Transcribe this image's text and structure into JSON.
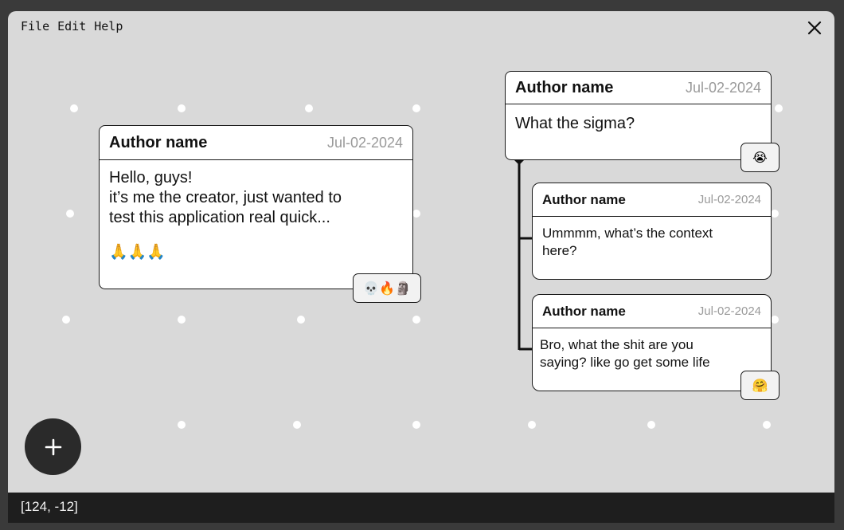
{
  "menu": {
    "file": "File",
    "edit": "Edit",
    "help": "Help"
  },
  "posts": {
    "main": {
      "author": "Author name",
      "date": "Jul-02-2024",
      "line1": "Hello, guys!",
      "line2": "it’s me the creator, just wanted to",
      "line3": "test this application real quick...",
      "emoji": "🙏🙏🙏",
      "reactions": "💀🔥🗿"
    },
    "thread": {
      "author": "Author name",
      "date": "Jul-02-2024",
      "text": "What the sigma?",
      "reactions": "😭"
    },
    "reply1": {
      "author": "Author name",
      "date": "Jul-02-2024",
      "line1": "Ummmm, what’s the context",
      "line2": "here?"
    },
    "reply2": {
      "author": "Author name",
      "date": "Jul-02-2024",
      "line1": "Bro, what the shit are you",
      "line2": "saying? like go get some life",
      "reactions": "🤗"
    }
  },
  "fab": {
    "label": "+"
  },
  "status": {
    "coords": "[124, -12]"
  },
  "icons": {
    "close": "close-icon",
    "add": "plus-icon"
  }
}
